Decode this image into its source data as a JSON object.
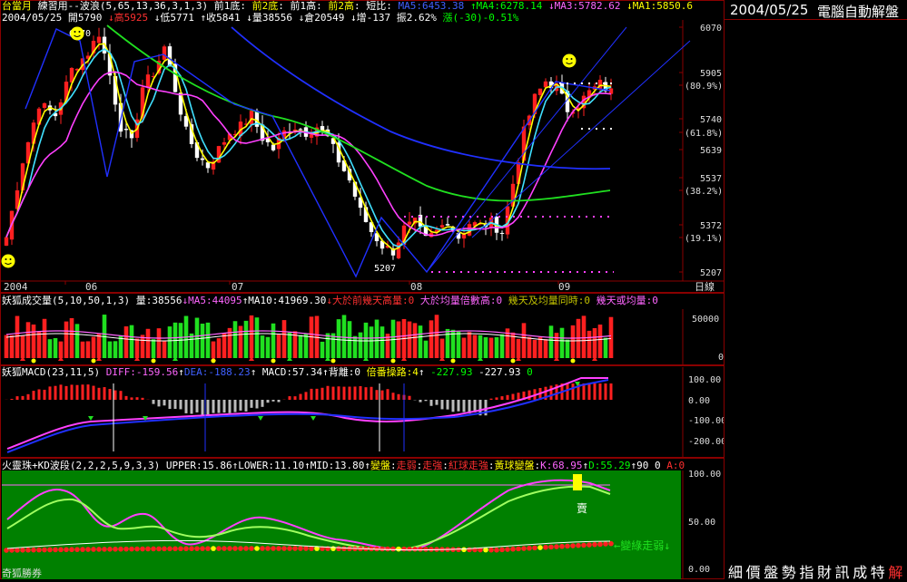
{
  "main": {
    "header_line1": [
      {
        "t": "台當月",
        "c": "#ffff00"
      },
      {
        "t": " 練習用--波浪(5,65,13,36,3,1,3) 前1底: ",
        "c": "#ffffff"
      },
      {
        "t": "前2底",
        "c": "#ffff00"
      },
      {
        "t": ": 前1高: ",
        "c": "#ffffff"
      },
      {
        "t": "前2高",
        "c": "#ffff00"
      },
      {
        "t": ": 短比: ",
        "c": "#ffffff"
      },
      {
        "t": "MA5:6453.38",
        "c": "#4060ff"
      },
      {
        "t": " ",
        "c": "#fff"
      },
      {
        "t": "↑MA4:6278.14",
        "c": "#00ff00"
      },
      {
        "t": " ",
        "c": "#fff"
      },
      {
        "t": "↓MA3:5782.62",
        "c": "#ff66ff"
      },
      {
        "t": " ",
        "c": "#fff"
      },
      {
        "t": "↓MA1:5850.6",
        "c": "#ffff00"
      }
    ],
    "header_line2": [
      {
        "t": "2004/05/25 ",
        "c": "#ffffff"
      },
      {
        "t": "開5790",
        "c": "#ffffff"
      },
      {
        "t": " ",
        "c": "#fff"
      },
      {
        "t": "↓高5925",
        "c": "#ff3030"
      },
      {
        "t": " ",
        "c": "#fff"
      },
      {
        "t": "↓低5771",
        "c": "#ffffff"
      },
      {
        "t": " ",
        "c": "#fff"
      },
      {
        "t": "↑收5841",
        "c": "#ffffff"
      },
      {
        "t": " ",
        "c": "#fff"
      },
      {
        "t": "↓量38556",
        "c": "#ffffff"
      },
      {
        "t": " ",
        "c": "#fff"
      },
      {
        "t": "↓倉20549",
        "c": "#ffffff"
      },
      {
        "t": " ",
        "c": "#fff"
      },
      {
        "t": "↓增-137 振2.62%",
        "c": "#ffffff"
      },
      {
        "t": " ",
        "c": "#fff"
      },
      {
        "t": "漲(-30)-0.51%",
        "c": "#00ff00"
      }
    ],
    "y_ticks": [
      {
        "v": "6070",
        "y": 30
      },
      {
        "v": "5905",
        "y": 80
      },
      {
        "v": "(80.9%)",
        "y": 94
      },
      {
        "v": "5740",
        "y": 131
      },
      {
        "v": "(61.8%)",
        "y": 146
      },
      {
        "v": "5639",
        "y": 165
      },
      {
        "v": "5537",
        "y": 196
      },
      {
        "v": "(38.2%)",
        "y": 210
      },
      {
        "v": "5372",
        "y": 248
      },
      {
        "v": "(19.1%)",
        "y": 262
      },
      {
        "v": "5207",
        "y": 300
      }
    ],
    "x_labels": [
      {
        "v": "2004",
        "x": 4
      },
      {
        "v": "06",
        "x": 94
      },
      {
        "v": "07",
        "x": 255
      },
      {
        "v": "08",
        "x": 452
      },
      {
        "v": "09",
        "x": 615
      },
      {
        "v": "日線",
        "x": 765
      }
    ],
    "annotations": {
      "high": "6070",
      "low": "5207"
    }
  },
  "vol": {
    "header": [
      {
        "t": "妖狐成交量(5,10,50,1,3) 量:38556",
        "c": "#ffffff"
      },
      {
        "t": "↓MA5:44095",
        "c": "#ff66ff"
      },
      {
        "t": "↑MA10:41969.30",
        "c": "#ffffff"
      },
      {
        "t": "↓大於前幾天高量:0",
        "c": "#ff3030"
      },
      {
        "t": " ",
        "c": "#fff"
      },
      {
        "t": "大於均量倍數高:0",
        "c": "#ff66ff"
      },
      {
        "t": " ",
        "c": "#fff"
      },
      {
        "t": "幾天及均量同時:0",
        "c": "#c0c000"
      },
      {
        "t": " ",
        "c": "#fff"
      },
      {
        "t": "幾天或均量:0",
        "c": "#ff66ff"
      }
    ],
    "y_ticks": [
      {
        "v": "50000",
        "y": 351
      },
      {
        "v": "0",
        "y": 393
      }
    ]
  },
  "macd": {
    "header": [
      {
        "t": "妖狐MACD(23,11,5) ",
        "c": "#ffffff"
      },
      {
        "t": "DIFF:-159.56",
        "c": "#ff66ff"
      },
      {
        "t": "↑",
        "c": "#fff"
      },
      {
        "t": "DEA:-188.23",
        "c": "#4060ff"
      },
      {
        "t": "↑ MACD:57.34↑背離:0 ",
        "c": "#ffffff"
      },
      {
        "t": "倍番操路:4",
        "c": "#ffff00"
      },
      {
        "t": "↑ ",
        "c": "#fff"
      },
      {
        "t": "-227.93",
        "c": "#00ff00"
      },
      {
        "t": " -227.93 ",
        "c": "#ffffff"
      },
      {
        "t": "0",
        "c": "#00ff00"
      }
    ],
    "y_ticks": [
      {
        "v": "100.00",
        "y": 418
      },
      {
        "v": "0.00",
        "y": 441
      },
      {
        "v": "-100.00",
        "y": 463
      },
      {
        "v": "-200.00",
        "y": 486
      }
    ]
  },
  "kd": {
    "header": [
      {
        "t": "火靈珠+KD波段(2,2,2,5,9,3,3) UPPER:15.86↑LOWER:11.10↑MID:13.80↑",
        "c": "#ffffff"
      },
      {
        "t": "變盤",
        "c": "#ffff00"
      },
      {
        "t": ":",
        "c": "#fff"
      },
      {
        "t": "走弱",
        "c": "#ff3030"
      },
      {
        "t": ":",
        "c": "#fff"
      },
      {
        "t": "走強",
        "c": "#ff3030"
      },
      {
        "t": ":",
        "c": "#fff"
      },
      {
        "t": "紅球走強",
        "c": "#ff3030"
      },
      {
        "t": ":",
        "c": "#fff"
      },
      {
        "t": "黃球變盤",
        "c": "#ffff00"
      },
      {
        "t": ":",
        "c": "#fff"
      },
      {
        "t": "K:68.95",
        "c": "#ff66ff"
      },
      {
        "t": "↑",
        "c": "#fff"
      },
      {
        "t": "D:55.29",
        "c": "#00ff00"
      },
      {
        "t": "↑90 0 ",
        "c": "#ffffff"
      },
      {
        "t": "A:0",
        "c": "#ff3030"
      }
    ],
    "y_ticks": [
      {
        "v": "100.00",
        "y": 522
      },
      {
        "v": "50.00",
        "y": 575
      },
      {
        "v": "0.00",
        "y": 627
      }
    ],
    "sell_label": "賣",
    "weak_label": "←變綠走弱↓",
    "broker": "奇狐勝券"
  },
  "right_panel": {
    "date": "2004/05/25",
    "title": "電腦自動解盤",
    "bottom_chars": [
      "細",
      "價",
      "盤",
      "勢",
      "指",
      "財",
      "訊",
      "成",
      "特",
      "解"
    ]
  },
  "chart_data": {
    "type": "candlestick",
    "title": "台當月 日線",
    "ylim": [
      5207,
      6070
    ],
    "fib_levels": {
      "19.1%": 5372,
      "38.2%": 5537,
      "61.8%": 5740,
      "80.9%": 5905
    },
    "last_bar": {
      "date": "2004/05/25",
      "open": 5790,
      "high": 5925,
      "low": 5771,
      "close": 5841,
      "volume": 38556,
      "open_interest": 20549
    },
    "moving_averages": {
      "MA5": 6453.38,
      "MA4": 6278.14,
      "MA3": 5782.62,
      "MA1": 5850.6
    },
    "macd": {
      "DIFF": -159.56,
      "DEA": -188.23,
      "MACD": 57.34
    },
    "kd": {
      "K": 68.95,
      "D": 55.29,
      "UPPER": 15.86,
      "LOWER": 11.1,
      "MID": 13.8
    }
  }
}
